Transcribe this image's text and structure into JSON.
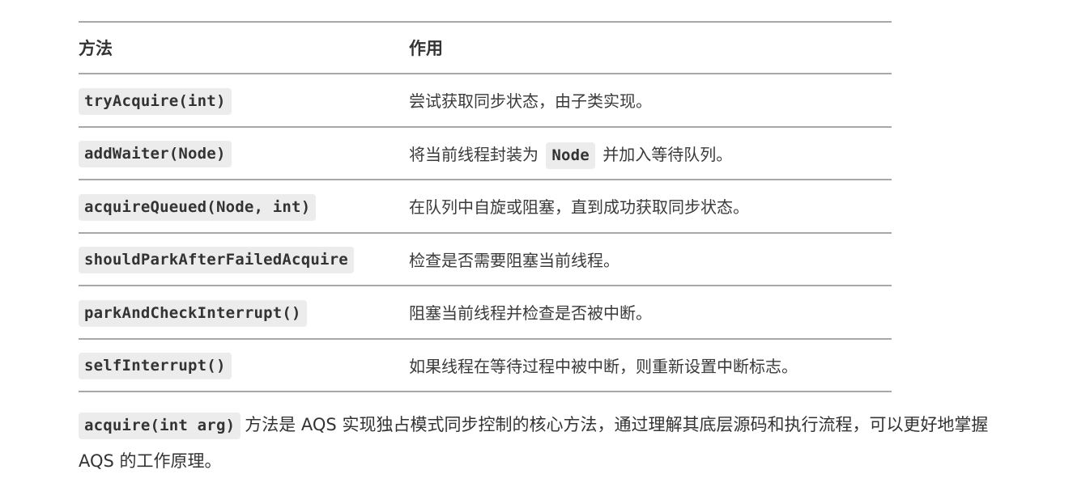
{
  "table": {
    "headers": [
      "方法",
      "作用"
    ],
    "rows": [
      {
        "method": "tryAcquire(int)",
        "desc_before": "尝试获取同步状态，由子类实现。",
        "desc_code": "",
        "desc_after": ""
      },
      {
        "method": "addWaiter(Node)",
        "desc_before": "将当前线程封装为",
        "desc_code": "Node",
        "desc_after": "并加入等待队列。"
      },
      {
        "method": "acquireQueued(Node, int)",
        "desc_before": "在队列中自旋或阻塞，直到成功获取同步状态。",
        "desc_code": "",
        "desc_after": ""
      },
      {
        "method": "shouldParkAfterFailedAcquire",
        "desc_before": "检查是否需要阻塞当前线程。",
        "desc_code": "",
        "desc_after": ""
      },
      {
        "method": "parkAndCheckInterrupt()",
        "desc_before": "阻塞当前线程并检查是否被中断。",
        "desc_code": "",
        "desc_after": ""
      },
      {
        "method": "selfInterrupt()",
        "desc_before": "如果线程在等待过程中被中断，则重新设置中断标志。",
        "desc_code": "",
        "desc_after": ""
      }
    ]
  },
  "summary": {
    "code": "acquire(int arg)",
    "text": "方法是 AQS 实现独占模式同步控制的核心方法，通过理解其底层源码和执行流程，可以更好地掌握 AQS 的工作原理。"
  },
  "colors": {
    "code_background": "#ececec",
    "rule": "#a8a8a8",
    "text": "#333333"
  }
}
